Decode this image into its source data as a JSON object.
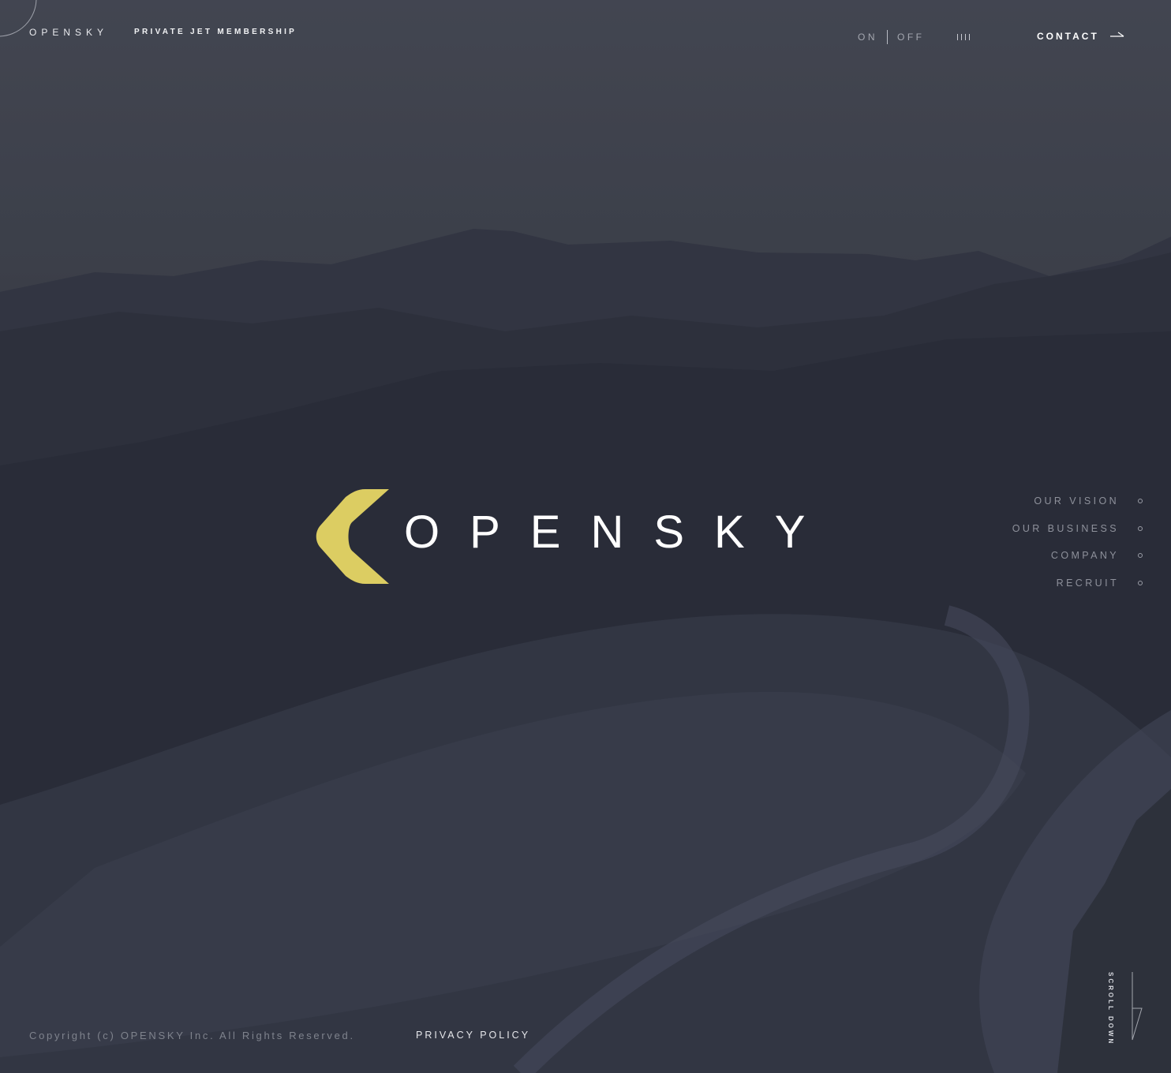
{
  "header": {
    "brand": "OPENSKY",
    "tagline": "PRIVATE JET MEMBERSHIP",
    "sound": {
      "on_label": "ON",
      "off_label": "OFF"
    },
    "contact_label": "CONTACT"
  },
  "hero": {
    "logotype": "OPENSKY",
    "accent_color": "#dccd62"
  },
  "side_nav": {
    "items": [
      {
        "label": "OUR VISION"
      },
      {
        "label": "OUR BUSINESS"
      },
      {
        "label": "COMPANY"
      },
      {
        "label": "RECRUIT"
      }
    ]
  },
  "footer": {
    "copyright": "Copyright (c) OPENSKY Inc. All Rights Reserved.",
    "privacy_label": "PRIVACY POLICY",
    "scroll_label": "SCROLL DOWN"
  },
  "icons": [
    "corner-arc-icon",
    "sound-bars-icon",
    "arrow-right-icon",
    "chevron-logo-icon",
    "nav-dot-icon",
    "scroll-arrow-icon"
  ]
}
